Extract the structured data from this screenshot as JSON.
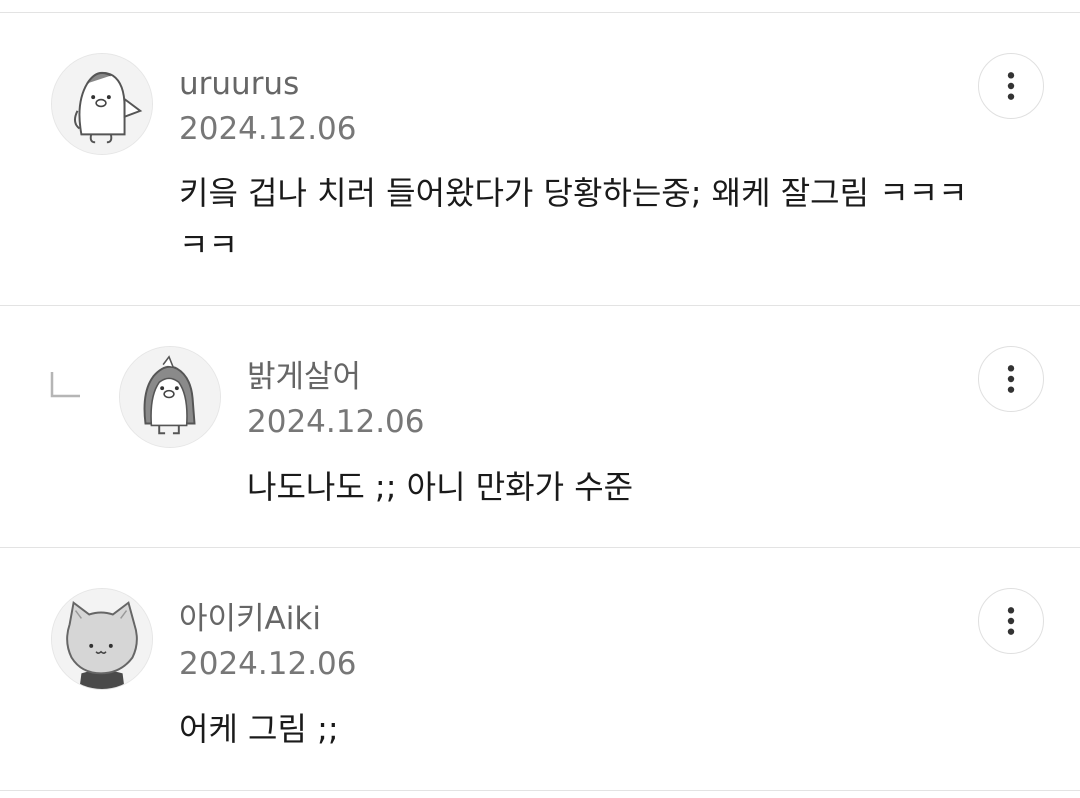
{
  "comments": [
    {
      "username": "uruurus",
      "date": "2024.12.06",
      "text": "키읔 겁나 치러 들어왔다가 당황하는중; 왜케 잘그림 ㅋㅋㅋㅋㅋ",
      "avatar_icon": "penguin-waving-icon",
      "more_icon": "more-vertical-icon"
    },
    {
      "username": "밝게살어",
      "date": "2024.12.06",
      "text": "나도나도 ;; 아니 만화가 수준",
      "avatar_icon": "penguin-icon",
      "more_icon": "more-vertical-icon",
      "reply_icon": "reply-arrow-icon"
    },
    {
      "username": "아이키Aiki",
      "date": "2024.12.06",
      "text": "어케 그림 ;;",
      "avatar_icon": "cat-icon",
      "more_icon": "more-vertical-icon"
    }
  ]
}
